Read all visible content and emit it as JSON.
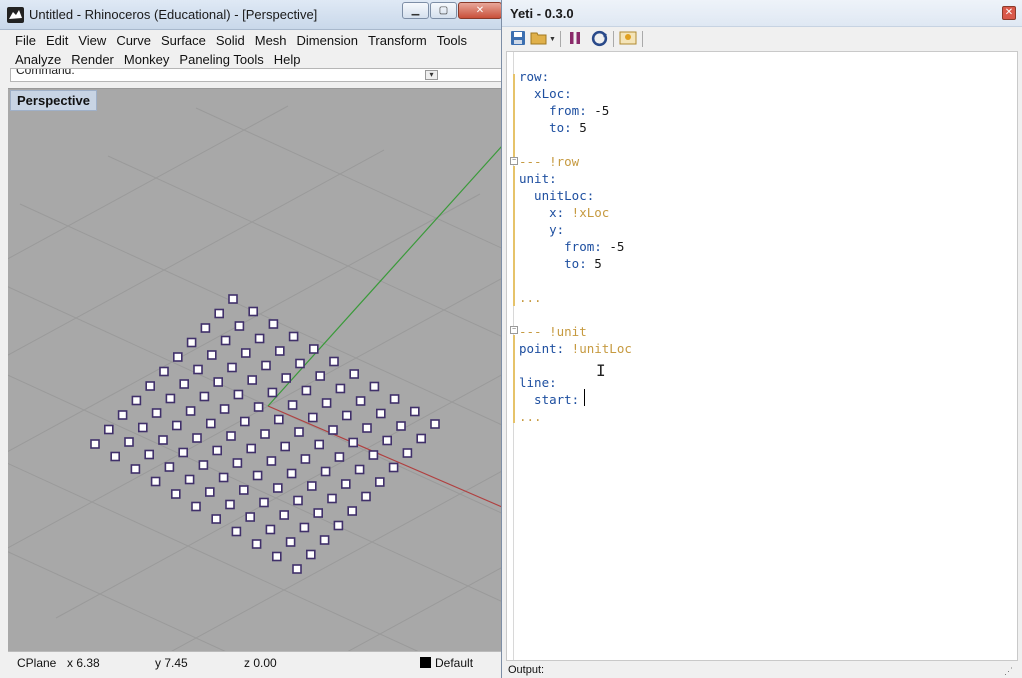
{
  "rhino": {
    "title": "Untitled - Rhinoceros (Educational) - [Perspective]",
    "window_buttons": {
      "minimize": "▁",
      "maximize": "▢",
      "close": "✕"
    },
    "menu_row1": [
      "File",
      "Edit",
      "View",
      "Curve",
      "Surface",
      "Solid",
      "Mesh",
      "Dimension",
      "Transform",
      "Tools"
    ],
    "menu_row2": [
      "Analyze",
      "Render",
      "Monkey",
      "Paneling Tools",
      "Help"
    ],
    "command_label": "Command:",
    "viewport_name": "Perspective",
    "status": {
      "cplane": "CPlane",
      "x": "x 6.38",
      "y": "y 7.45",
      "z": "z 0.00",
      "layer": "Default"
    },
    "colors": {
      "viewport_bg": "#a8a8a8",
      "grid": "#9a9a9a",
      "x_axis": "#b04040",
      "y_axis": "#3a9a3a",
      "point_marker": "#40306a"
    },
    "point_grid": {
      "rows": 11,
      "cols": 11
    }
  },
  "yeti": {
    "title": "Yeti - 0.3.0",
    "close": "✕",
    "toolbar": {
      "save_icon": "save-icon",
      "open_icon": "folder-open-icon",
      "pause_icon": "pause-icon",
      "refresh_icon": "refresh-icon",
      "render_icon": "render-icon"
    },
    "code": [
      [
        [
          "key",
          "row:"
        ]
      ],
      [
        [
          "key",
          "  xLoc:"
        ]
      ],
      [
        [
          "key",
          "    from:"
        ],
        [
          "val",
          " -5"
        ]
      ],
      [
        [
          "key",
          "    to:"
        ],
        [
          "val",
          " 5"
        ]
      ],
      [],
      [
        [
          "tag",
          "--- !row"
        ]
      ],
      [
        [
          "key",
          "unit:"
        ]
      ],
      [
        [
          "key",
          "  unitLoc:"
        ]
      ],
      [
        [
          "key",
          "    x:"
        ],
        [
          "tag",
          " !xLoc"
        ]
      ],
      [
        [
          "key",
          "    y:"
        ]
      ],
      [
        [
          "key",
          "      from:"
        ],
        [
          "val",
          " -5"
        ]
      ],
      [
        [
          "key",
          "      to:"
        ],
        [
          "val",
          " 5"
        ]
      ],
      [],
      [
        [
          "dots",
          "..."
        ]
      ],
      [],
      [
        [
          "tag",
          "--- !unit"
        ]
      ],
      [
        [
          "key",
          "point:"
        ],
        [
          "tag",
          " !unitLoc"
        ]
      ],
      [],
      [
        [
          "key",
          "line:"
        ]
      ],
      [
        [
          "key",
          "  start:"
        ],
        [
          "val",
          " "
        ]
      ],
      [
        [
          "dots",
          "..."
        ]
      ]
    ],
    "output_label": "Output:"
  }
}
